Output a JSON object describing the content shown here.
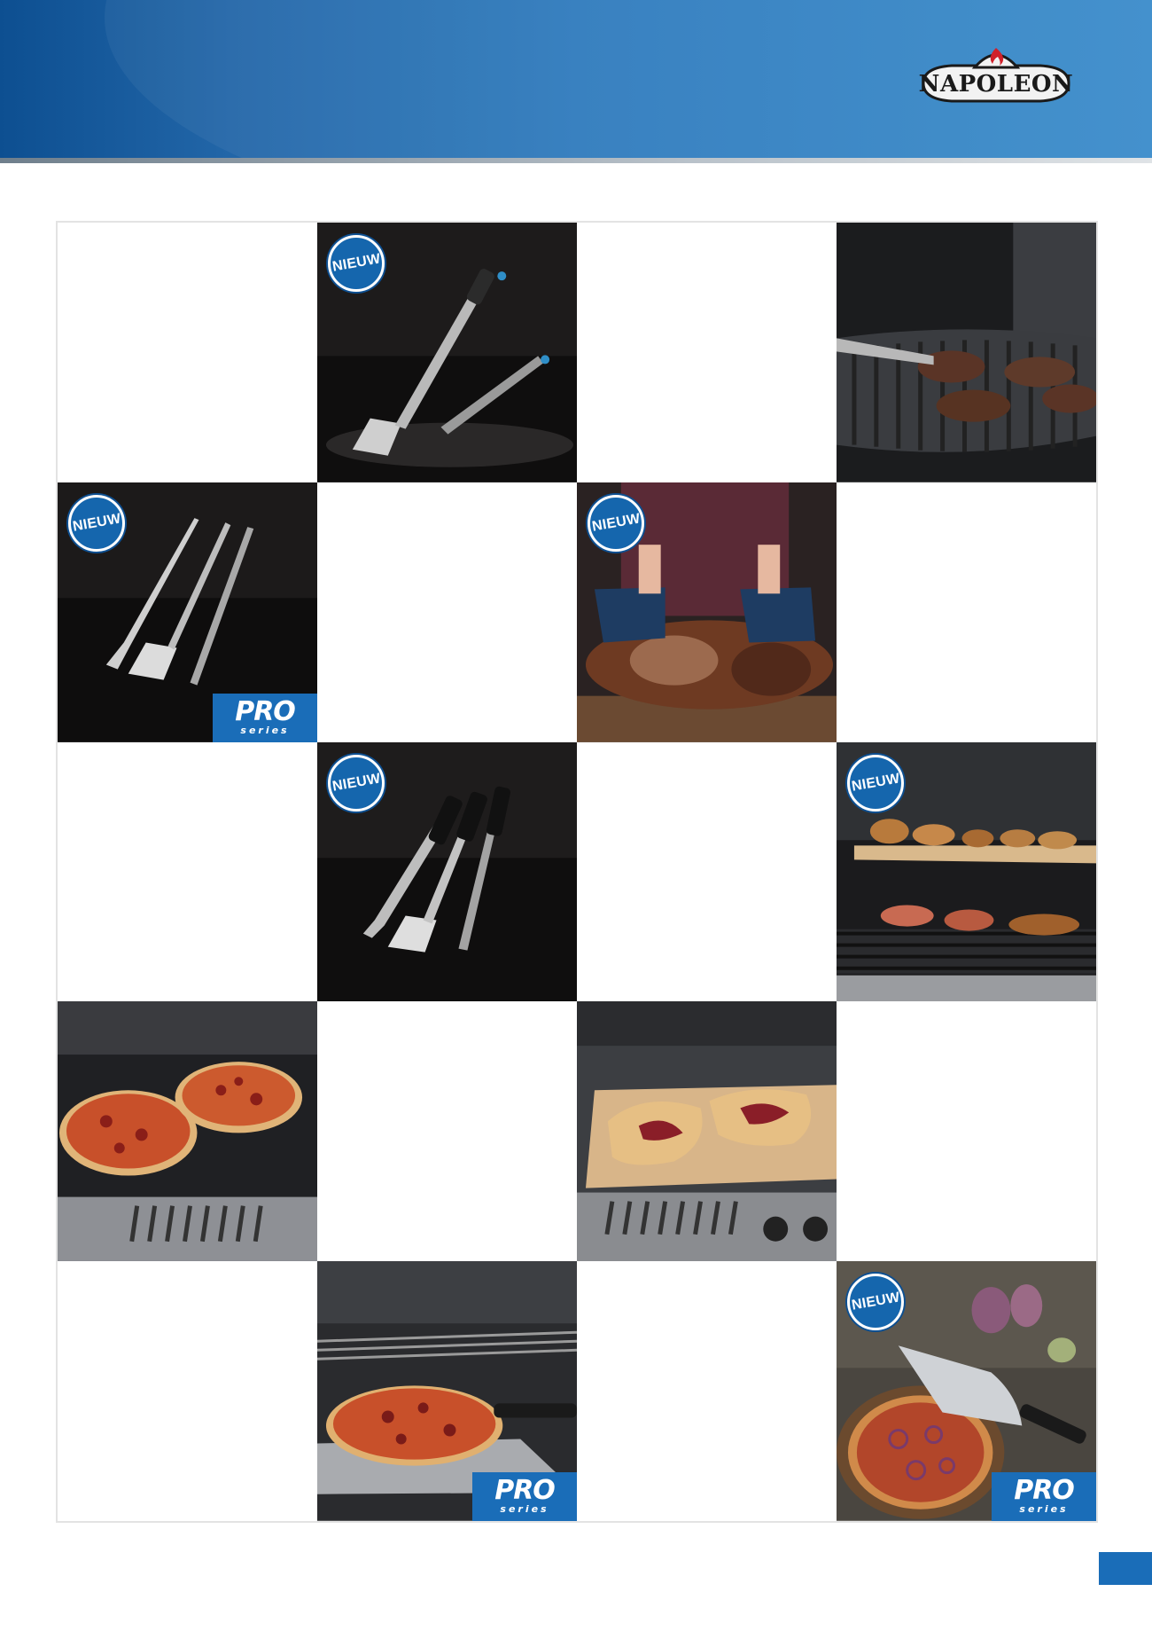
{
  "brand": {
    "name": "NAPOLEON",
    "accent": "#1a6db8",
    "header_color": "#2266a8"
  },
  "badge_text": "NIEUW",
  "pro_badge": {
    "line1": "PRO",
    "line2": "series"
  },
  "grid": [
    [
      {
        "type": "empty"
      },
      {
        "type": "photo",
        "subject": "stainless spatula and tongs with blue grips",
        "new": true,
        "pro": false
      },
      {
        "type": "empty"
      },
      {
        "type": "photo",
        "subject": "tongs lifting burgers on grill",
        "new": false,
        "pro": false
      }
    ],
    [
      {
        "type": "photo",
        "subject": "three-piece stainless toolset",
        "new": true,
        "pro": true
      },
      {
        "type": "empty"
      },
      {
        "type": "photo",
        "subject": "meat shredder claws pulling pork",
        "new": true,
        "pro": false
      },
      {
        "type": "empty"
      }
    ],
    [
      {
        "type": "empty"
      },
      {
        "type": "photo",
        "subject": "three-piece toolset with black grips",
        "new": true,
        "pro": false
      },
      {
        "type": "empty"
      },
      {
        "type": "photo",
        "subject": "cedar plank warming rack with pastries",
        "new": true,
        "pro": false
      }
    ],
    [
      {
        "type": "photo",
        "subject": "two pizzas on grill grate",
        "new": false,
        "pro": false
      },
      {
        "type": "empty"
      },
      {
        "type": "photo",
        "subject": "pizza stone with pastries on grill",
        "new": false,
        "pro": false
      },
      {
        "type": "empty"
      }
    ],
    [
      {
        "type": "empty"
      },
      {
        "type": "photo",
        "subject": "pizza peel with pizza at grill",
        "new": false,
        "pro": true
      },
      {
        "type": "empty"
      },
      {
        "type": "photo",
        "subject": "rocking pizza cutter on board",
        "new": true,
        "pro": true
      }
    ]
  ]
}
